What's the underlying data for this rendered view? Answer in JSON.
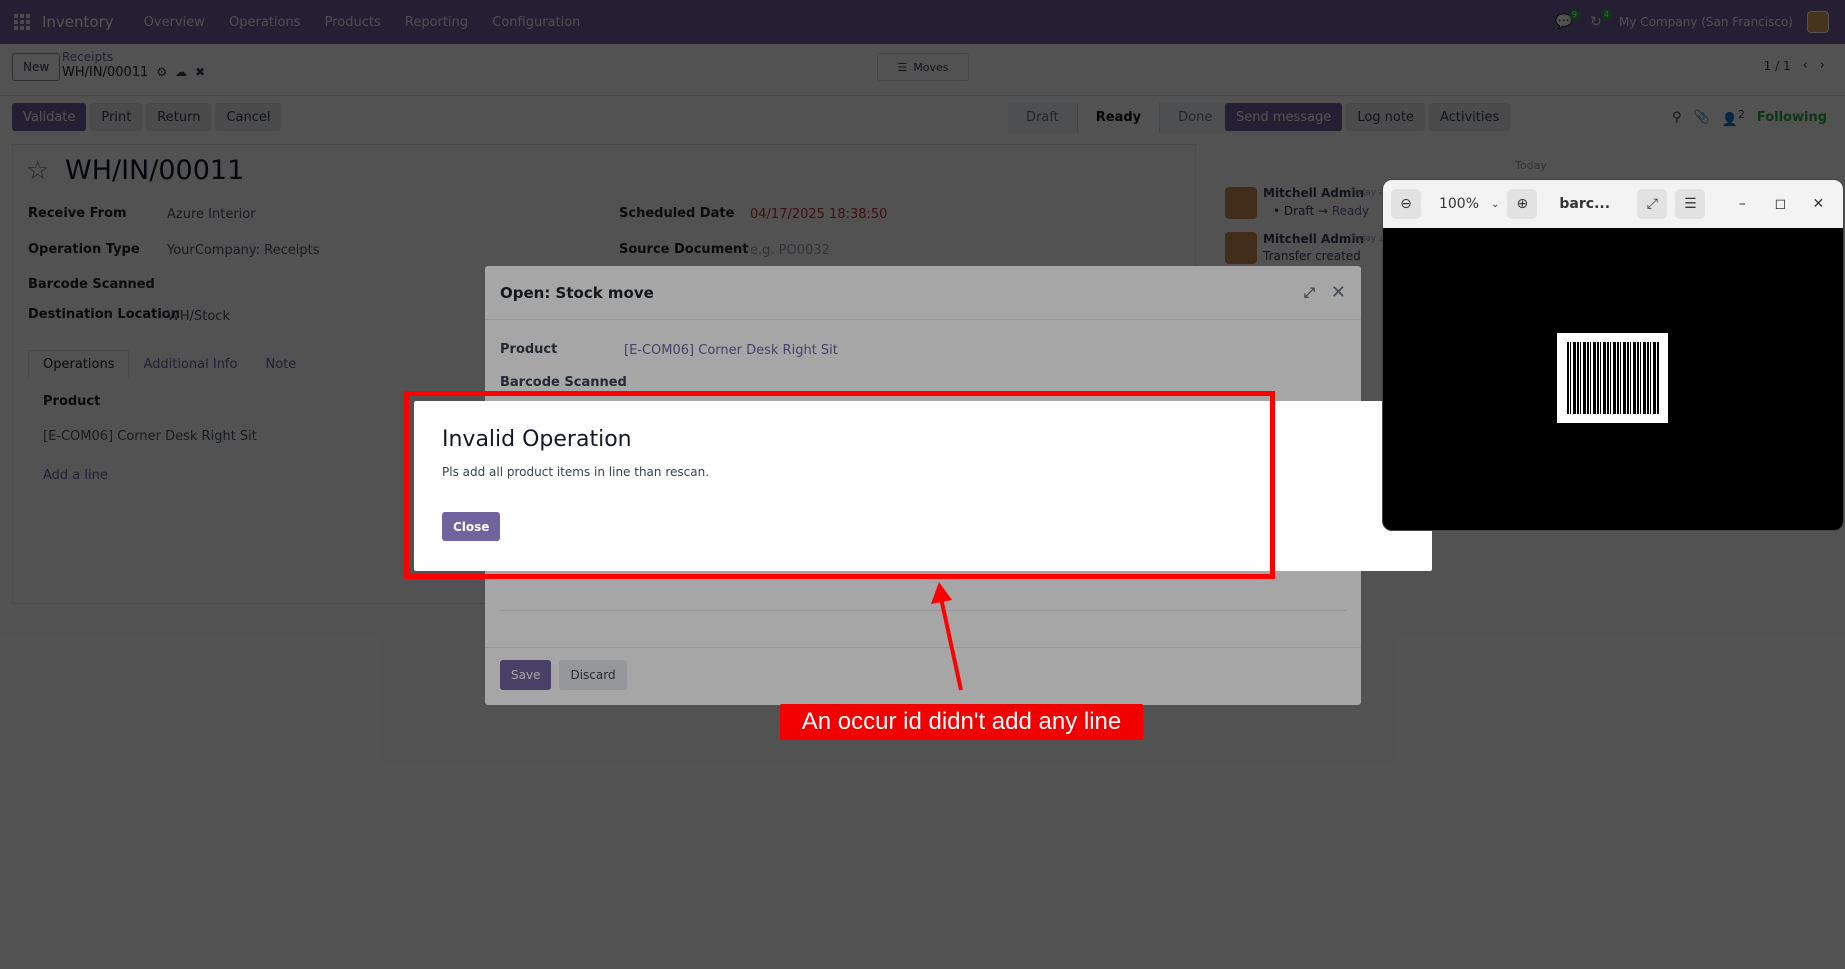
{
  "topbar": {
    "app_name": "Inventory",
    "menu": [
      "Overview",
      "Operations",
      "Products",
      "Reporting",
      "Configuration"
    ],
    "messages_badge": "9",
    "activities_badge": "4",
    "company": "My Company (San Francisco)"
  },
  "control": {
    "new_label": "New",
    "breadcrumb_parent": "Receipts",
    "breadcrumb_current": "WH/IN/00011",
    "view_switch": "Moves",
    "pager": "1 / 1"
  },
  "actions": {
    "validate": "Validate",
    "print": "Print",
    "return": "Return",
    "cancel": "Cancel"
  },
  "statusbar": [
    "Draft",
    "Ready",
    "Done"
  ],
  "chatter": {
    "send_message": "Send message",
    "log_note": "Log note",
    "activities": "Activities",
    "followers_count": "2",
    "following": "Following",
    "date_sep": "Today",
    "msg1_author": "Mitchell Admin",
    "msg1_time": "Today at",
    "msg1_from": "Draft",
    "msg1_to": "Ready",
    "msg2_author": "Mitchell Admin",
    "msg2_time": "Today at",
    "msg2_body": "Transfer created"
  },
  "form": {
    "title": "WH/IN/00011",
    "receive_from_label": "Receive From",
    "receive_from": "Azure Interior",
    "operation_type_label": "Operation Type",
    "operation_type": "YourCompany: Receipts",
    "barcode_label": "Barcode Scanned",
    "dest_label": "Destination Location",
    "dest": "WH/Stock",
    "scheduled_label": "Scheduled Date",
    "scheduled": "04/17/2025 18:38:50",
    "source_label": "Source Document",
    "source_placeholder": "e.g. PO0032",
    "tabs": [
      "Operations",
      "Additional Info",
      "Note"
    ],
    "col_product": "Product",
    "line_product": "[E-COM06] Corner Desk Right Sit",
    "add_line": "Add a line"
  },
  "stock_modal": {
    "title": "Open: Stock move",
    "product_label": "Product",
    "product": "[E-COM06] Corner Desk Right Sit",
    "barcode_label": "Barcode Scanned",
    "save": "Save",
    "discard": "Discard"
  },
  "error_dialog": {
    "title": "Invalid Operation",
    "message": "Pls add all product items in line than rescan.",
    "close": "Close"
  },
  "annotation": "An occur id didn't add any line",
  "viewer": {
    "zoom": "100%",
    "title": "barc..."
  },
  "colors": {
    "brand": "#71639e",
    "annotation_red": "#ff0000",
    "scheduled_date": "#c0392b"
  }
}
